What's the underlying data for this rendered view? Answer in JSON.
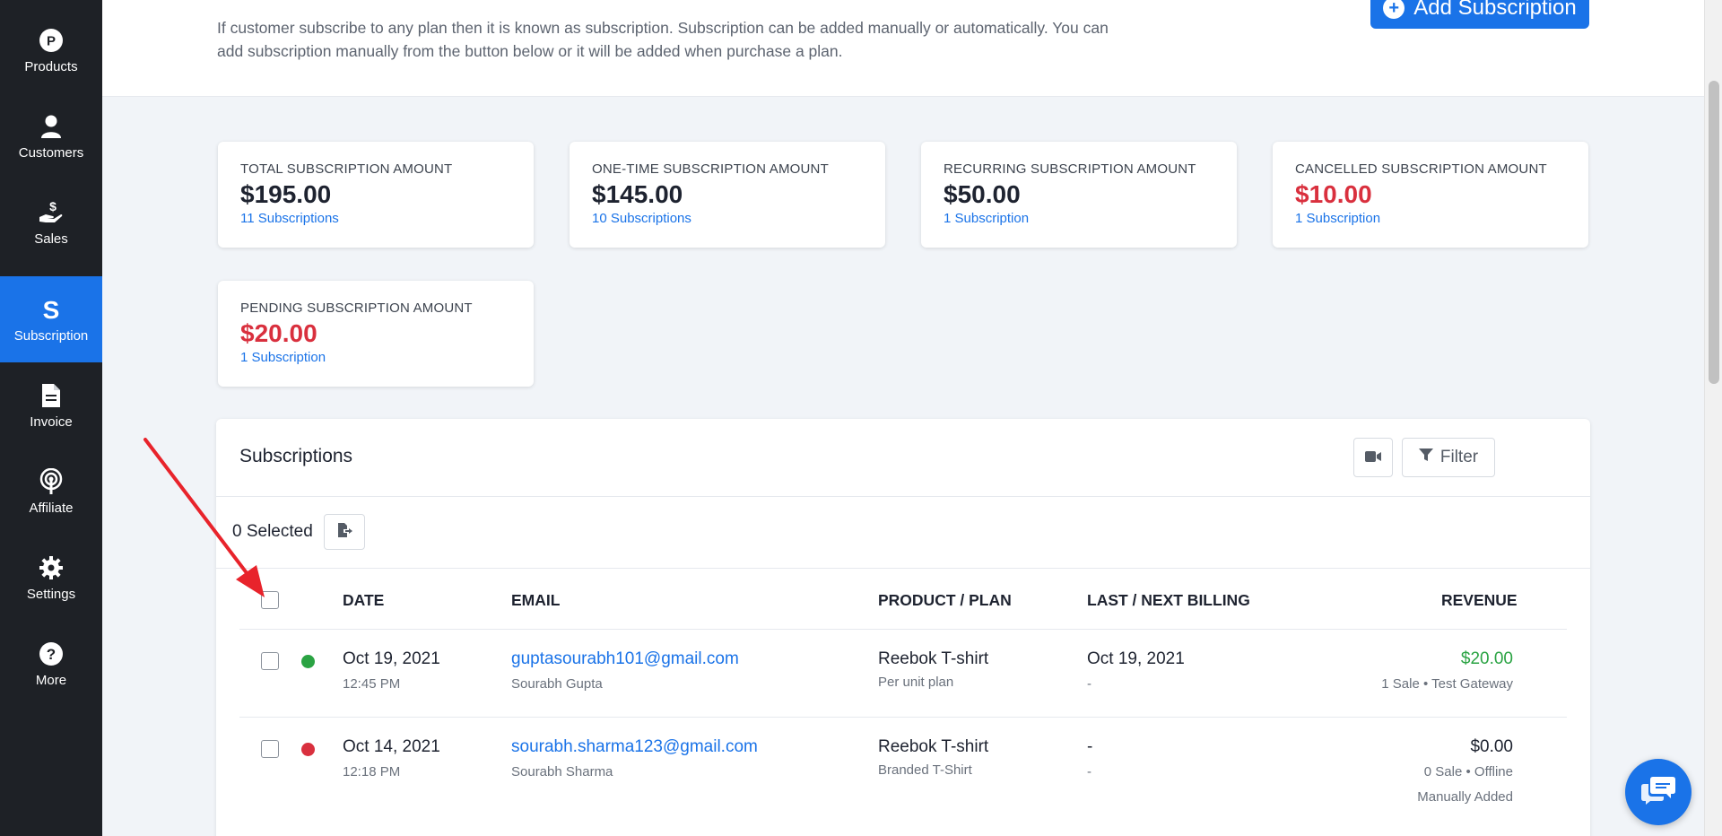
{
  "sidebar": {
    "items": [
      {
        "label": "Products",
        "icon": "products-icon"
      },
      {
        "label": "Customers",
        "icon": "user-icon"
      },
      {
        "label": "Sales",
        "icon": "hand-dollar-icon"
      },
      {
        "label": "Subscription",
        "icon": "subscription-s-icon",
        "active": true
      },
      {
        "label": "Invoice",
        "icon": "document-icon"
      },
      {
        "label": "Affiliate",
        "icon": "broadcast-icon"
      },
      {
        "label": "Settings",
        "icon": "gear-icon"
      },
      {
        "label": "More",
        "icon": "help-icon"
      }
    ]
  },
  "header": {
    "description": "If customer subscribe to any plan then it is known as subscription. Subscription can be added manually or automatically. You can add subscription manually from the button below or it will be added when purchase a plan.",
    "add_button": "Add Subscription"
  },
  "stats": [
    {
      "title": "TOTAL SUBSCRIPTION AMOUNT",
      "amount": "$195.00",
      "link": "11 Subscriptions",
      "red": false
    },
    {
      "title": "ONE-TIME SUBSCRIPTION AMOUNT",
      "amount": "$145.00",
      "link": "10 Subscriptions",
      "red": false
    },
    {
      "title": "RECURRING SUBSCRIPTION AMOUNT",
      "amount": "$50.00",
      "link": "1 Subscription",
      "red": false
    },
    {
      "title": "CANCELLED SUBSCRIPTION AMOUNT",
      "amount": "$10.00",
      "link": "1 Subscription",
      "red": true
    },
    {
      "title": "PENDING SUBSCRIPTION AMOUNT",
      "amount": "$20.00",
      "link": "1 Subscription",
      "red": true
    }
  ],
  "panel": {
    "title": "Subscriptions",
    "filter_label": "Filter",
    "selected_label": "0 Selected"
  },
  "table": {
    "headers": [
      "DATE",
      "EMAIL",
      "PRODUCT / PLAN",
      "LAST / NEXT BILLING",
      "REVENUE"
    ],
    "rows": [
      {
        "status_color": "#2aa343",
        "date": "Oct 19, 2021",
        "time": "12:45 PM",
        "email": "guptasourabh101@gmail.com",
        "name": "Sourabh Gupta",
        "product": "Reebok T-shirt",
        "plan": "Per unit plan",
        "billing": "Oct 19, 2021",
        "billing_next": "-",
        "revenue": "$20.00",
        "revenue_sub": "1 Sale • Test Gateway",
        "revenue_note": "",
        "revenue_green": true
      },
      {
        "status_color": "#d9303e",
        "date": "Oct 14, 2021",
        "time": "12:18 PM",
        "email": "sourabh.sharma123@gmail.com",
        "name": "Sourabh Sharma",
        "product": "Reebok T-shirt",
        "plan": "Branded T-Shirt",
        "billing": "-",
        "billing_next": "-",
        "revenue": "$0.00",
        "revenue_sub": "0 Sale • Offline",
        "revenue_note": "Manually Added",
        "revenue_green": false
      }
    ]
  },
  "colors": {
    "accent": "#1a73e8",
    "sidebar": "#1e2126",
    "danger": "#d9303e",
    "success": "#2aa343",
    "annotation_arrow": "#e8232b"
  }
}
